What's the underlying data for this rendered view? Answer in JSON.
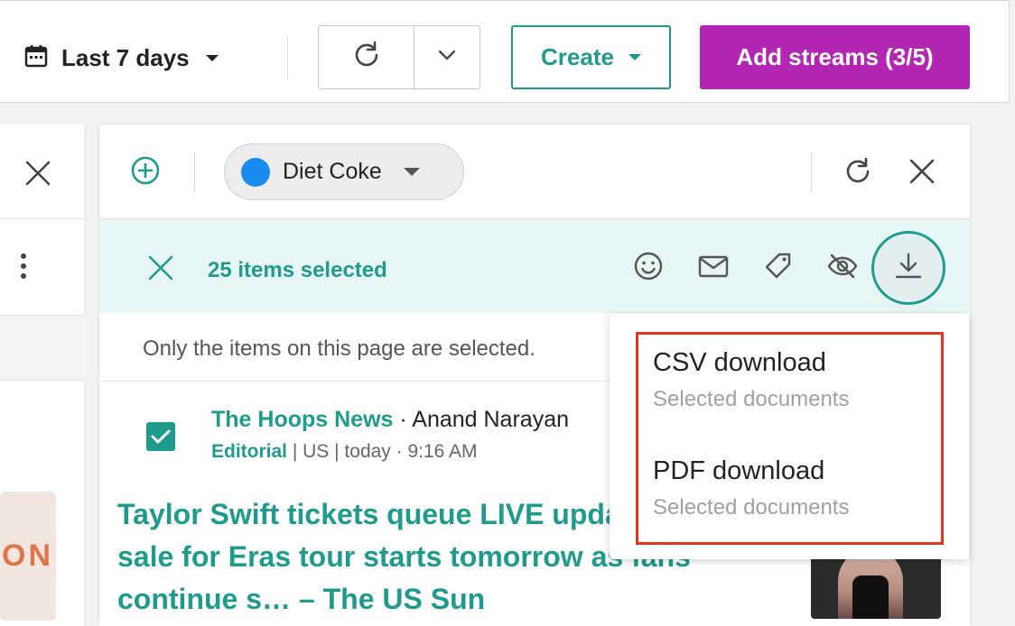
{
  "toolbar": {
    "date_range_label": "Last 7 days",
    "create_label": "Create",
    "add_streams_label": "Add streams (3/5)"
  },
  "left_panel": {
    "thumb_text": "ON"
  },
  "stream": {
    "name": "Diet Coke",
    "color": "#1a8cf0"
  },
  "selection": {
    "count_label": "25 items selected",
    "notice": "Only the items on this page are selected."
  },
  "article": {
    "source": "The Hoops News",
    "separator": " · ",
    "author": "Anand Narayan",
    "type": "Editorial",
    "meta_rest": " | US | today · 9:16 AM",
    "headline": "Taylor Swift tickets queue LIVE updates: General sale for Eras tour starts tomorrow as fans continue s… – The US Sun"
  },
  "download_menu": {
    "items": [
      {
        "title": "CSV download",
        "subtitle": "Selected documents"
      },
      {
        "title": "PDF download",
        "subtitle": "Selected documents"
      }
    ]
  },
  "colors": {
    "accent": "#1f9b8e",
    "brand_purple": "#b326b3",
    "highlight_red": "#e8341c"
  }
}
